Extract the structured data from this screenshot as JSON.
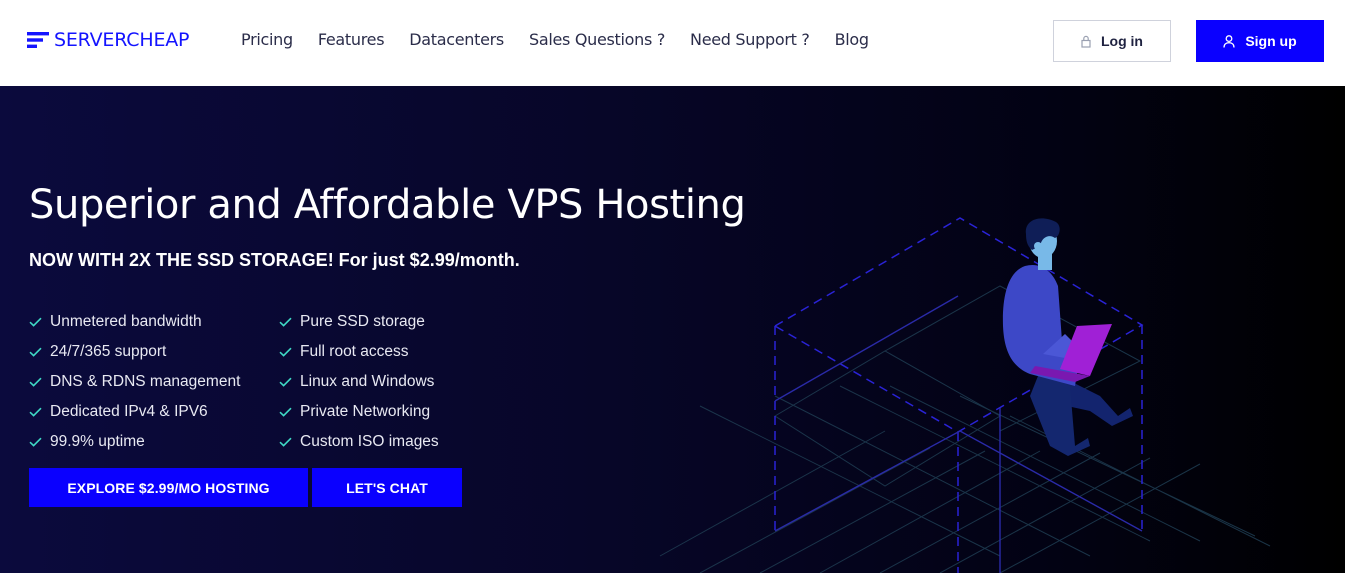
{
  "header": {
    "logo_text": "SERVERCHEAP",
    "nav": [
      {
        "label": "Pricing"
      },
      {
        "label": "Features"
      },
      {
        "label": "Datacenters"
      },
      {
        "label": "Sales Questions ?"
      },
      {
        "label": "Need Support ?"
      },
      {
        "label": "Blog"
      }
    ],
    "login_label": "Log in",
    "signup_label": "Sign up"
  },
  "hero": {
    "title": "Superior and Affordable VPS Hosting",
    "subtitle": "NOW WITH 2X THE SSD STORAGE! For just $2.99/month.",
    "features_left": [
      "Unmetered bandwidth",
      "24/7/365 support",
      "DNS & RDNS management",
      "Dedicated IPv4 & IPV6",
      "99.9% uptime"
    ],
    "features_right": [
      "Pure SSD storage",
      "Full root access",
      "Linux and Windows",
      "Private Networking",
      "Custom ISO images"
    ],
    "cta_primary": "EXPLORE $2.99/MO HOSTING",
    "cta_secondary": "LET'S CHAT"
  },
  "colors": {
    "brand": "#0a00ff",
    "check": "#3fd8c4",
    "nav_text": "#2b2d4a"
  },
  "icons": {
    "logo": "stacked-bars-logo-icon",
    "login": "lock-icon",
    "signup": "user-icon",
    "feature": "check-icon"
  }
}
